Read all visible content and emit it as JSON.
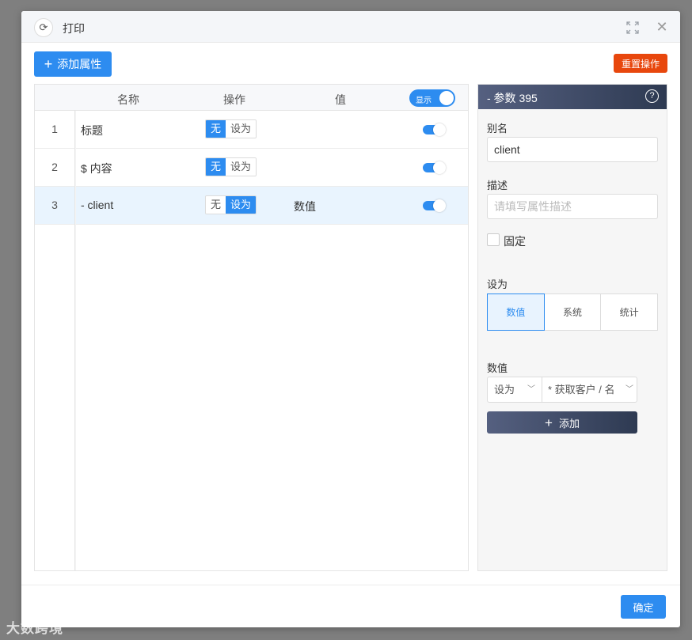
{
  "dialog": {
    "title": "打印",
    "refresh_icon": "⟳",
    "close_icon": "✕"
  },
  "toolbar": {
    "add_attr_label": "添加属性",
    "reset_label": "重置操作"
  },
  "table": {
    "headers": {
      "name": "名称",
      "operation": "操作",
      "value": "值",
      "show_toggle": "显示"
    },
    "rows": [
      {
        "index": "1",
        "name": "标题",
        "op_none": "无",
        "op_set": "设为",
        "op_active": "none",
        "value": "",
        "visible": true
      },
      {
        "index": "2",
        "name": "$ 内容",
        "op_none": "无",
        "op_set": "设为",
        "op_active": "none",
        "value": "",
        "visible": true
      },
      {
        "index": "3",
        "name": "- client",
        "op_none": "无",
        "op_set": "设为",
        "op_active": "set",
        "value": "数值",
        "visible": true
      }
    ]
  },
  "panel": {
    "title": "- 参数 395",
    "help_icon": "?",
    "alias_label": "别名",
    "alias_value": "client",
    "desc_label": "描述",
    "desc_placeholder": "请填写属性描述",
    "fixed_label": "固定",
    "set_as_label": "设为",
    "set_as_options": [
      "数值",
      "系统",
      "统计"
    ],
    "set_as_selected": "数值",
    "value_label": "数值",
    "select1_value": "设为",
    "select2_value": "* 获取客户 / 名",
    "add_label": "添加"
  },
  "footer": {
    "confirm_label": "确定"
  },
  "watermark": "大数跨境",
  "colors": {
    "primary": "#2d8cf0",
    "danger": "#e8470d",
    "panel_header": "#3a4560"
  }
}
